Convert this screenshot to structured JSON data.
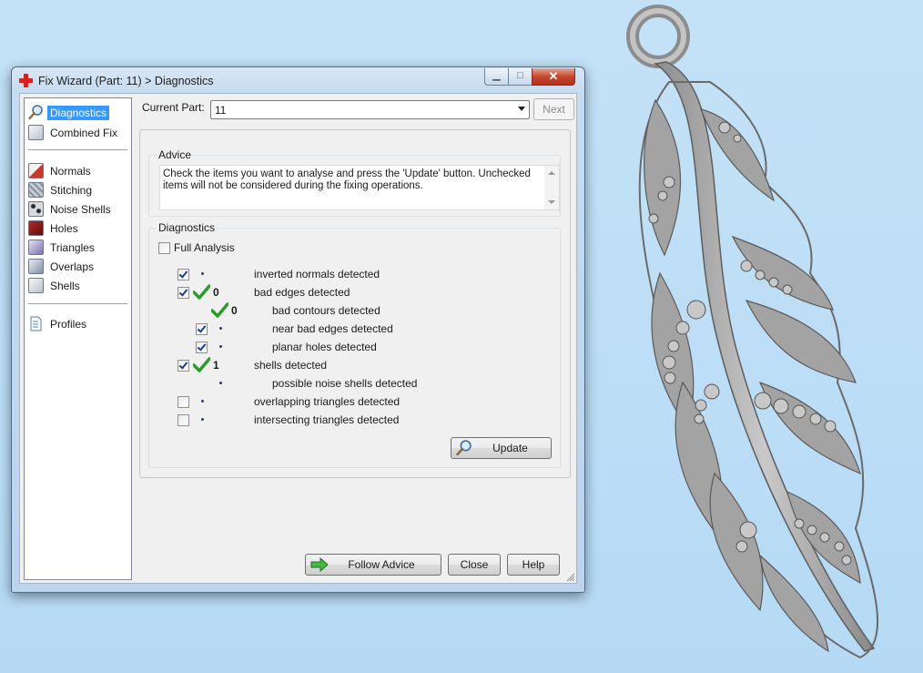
{
  "window": {
    "title": "Fix Wizard (Part: 11) > Diagnostics",
    "min_label": "▁",
    "max_label": "□",
    "close_label": "✕"
  },
  "sidebar": {
    "items": [
      {
        "label": "Diagnostics",
        "icon": "magnifier-icon"
      },
      {
        "label": "Combined Fix",
        "icon": "cube-icon"
      },
      {
        "label": "Normals",
        "icon": "normals-cube-icon"
      },
      {
        "label": "Stitching",
        "icon": "stitching-icon"
      },
      {
        "label": "Noise Shells",
        "icon": "noise-shells-icon"
      },
      {
        "label": "Holes",
        "icon": "holes-icon"
      },
      {
        "label": "Triangles",
        "icon": "triangles-icon"
      },
      {
        "label": "Overlaps",
        "icon": "overlaps-icon"
      },
      {
        "label": "Shells",
        "icon": "shells-icon"
      },
      {
        "label": "Profiles",
        "icon": "document-icon"
      }
    ]
  },
  "current_part": {
    "label": "Current Part:",
    "value": "11"
  },
  "next_button": "Next",
  "advice": {
    "title": "Advice",
    "text": "Check the items you want to analyse and press the 'Update' button. Unchecked items will not be considered during the fixing operations."
  },
  "diagnostics": {
    "title": "Diagnostics",
    "full_analysis_label": "Full Analysis",
    "full_analysis_checked": false,
    "rows": [
      {
        "label": "inverted normals detected",
        "checked": true,
        "count": ""
      },
      {
        "label": "bad edges detected",
        "checked": true,
        "count": "0"
      },
      {
        "label": "bad contours detected",
        "checked": null,
        "count": "0"
      },
      {
        "label": "near bad edges detected",
        "checked": true,
        "count": ""
      },
      {
        "label": "planar holes detected",
        "checked": true,
        "count": ""
      },
      {
        "label": "shells detected",
        "checked": true,
        "count": "1"
      },
      {
        "label": "possible noise shells detected",
        "checked": null,
        "count": ""
      },
      {
        "label": "overlapping triangles detected",
        "checked": false,
        "count": ""
      },
      {
        "label": "intersecting triangles detected",
        "checked": false,
        "count": ""
      }
    ],
    "update_button": "Update"
  },
  "footer": {
    "follow_advice": "Follow Advice",
    "close": "Close",
    "help": "Help"
  },
  "colors": {
    "selection": "#3399ff",
    "close_button": "#c6482f",
    "tick_green": "#2e9b2e",
    "background": "#bcdff7"
  }
}
